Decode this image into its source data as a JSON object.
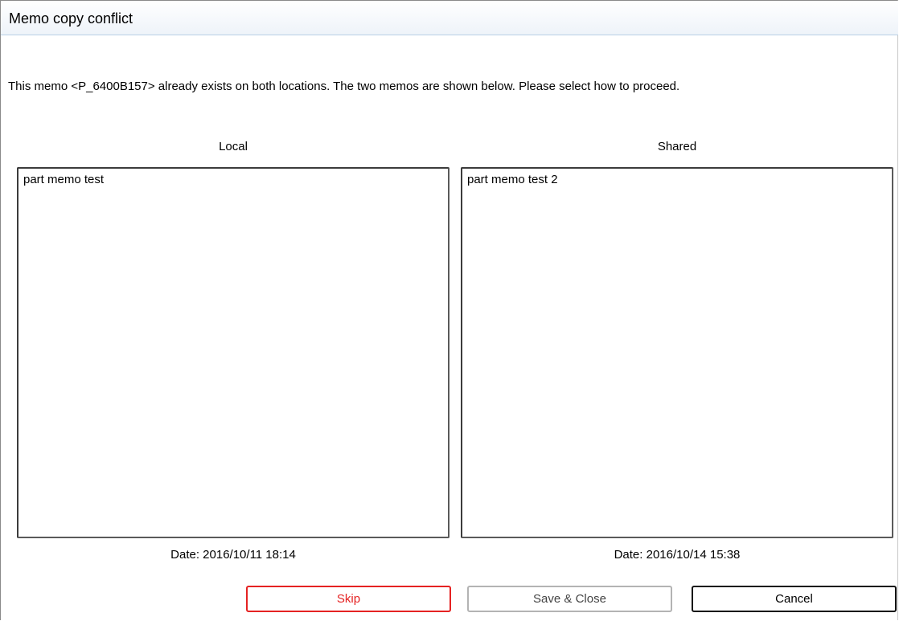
{
  "window": {
    "title": "Memo copy conflict"
  },
  "message": "This memo <P_6400B157> already exists on both locations. The two memos are shown below. Please select how to proceed.",
  "local": {
    "label": "Local",
    "content": "part memo test",
    "date": "Date: 2016/10/11 18:14"
  },
  "shared": {
    "label": "Shared",
    "content": "part memo test 2",
    "date": "Date: 2016/10/14 15:38"
  },
  "buttons": {
    "skip": "Skip",
    "save_close": "Save & Close",
    "cancel": "Cancel"
  },
  "colors": {
    "skip_accent": "#e52222",
    "save_border": "#b3b3b3",
    "cancel_border": "#111111",
    "titlebar_border": "#b9cfe6"
  }
}
